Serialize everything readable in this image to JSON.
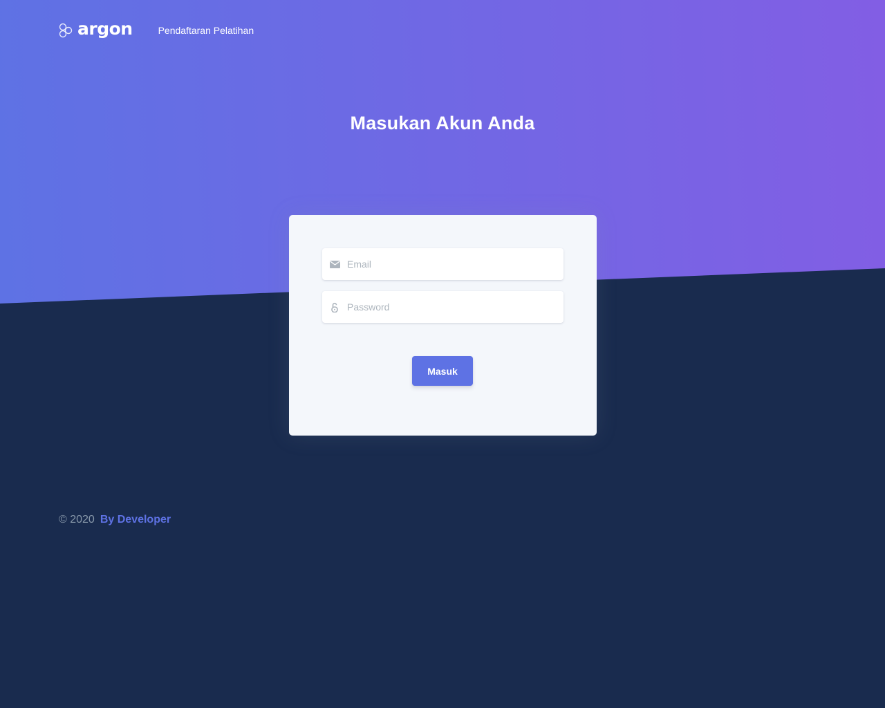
{
  "navbar": {
    "brand_name": "argon",
    "brand_icon": "argon-logo-icon",
    "links": [
      {
        "label": "Pendaftaran Pelatihan"
      }
    ]
  },
  "header": {
    "title": "Masukan Akun Anda"
  },
  "login_form": {
    "email": {
      "placeholder": "Email",
      "value": "",
      "icon": "envelope-icon"
    },
    "password": {
      "placeholder": "Password",
      "value": "",
      "icon": "lock-icon"
    },
    "submit_label": "Masuk"
  },
  "footer": {
    "copyright": "© 2020",
    "link_label": "By Developer"
  },
  "colors": {
    "gradient_start": "#5e72e4",
    "gradient_end": "#825ee4",
    "background_dark": "#192b4e",
    "card_background": "#f4f7fb",
    "primary": "#5e72e4",
    "muted_text": "#8898aa"
  }
}
